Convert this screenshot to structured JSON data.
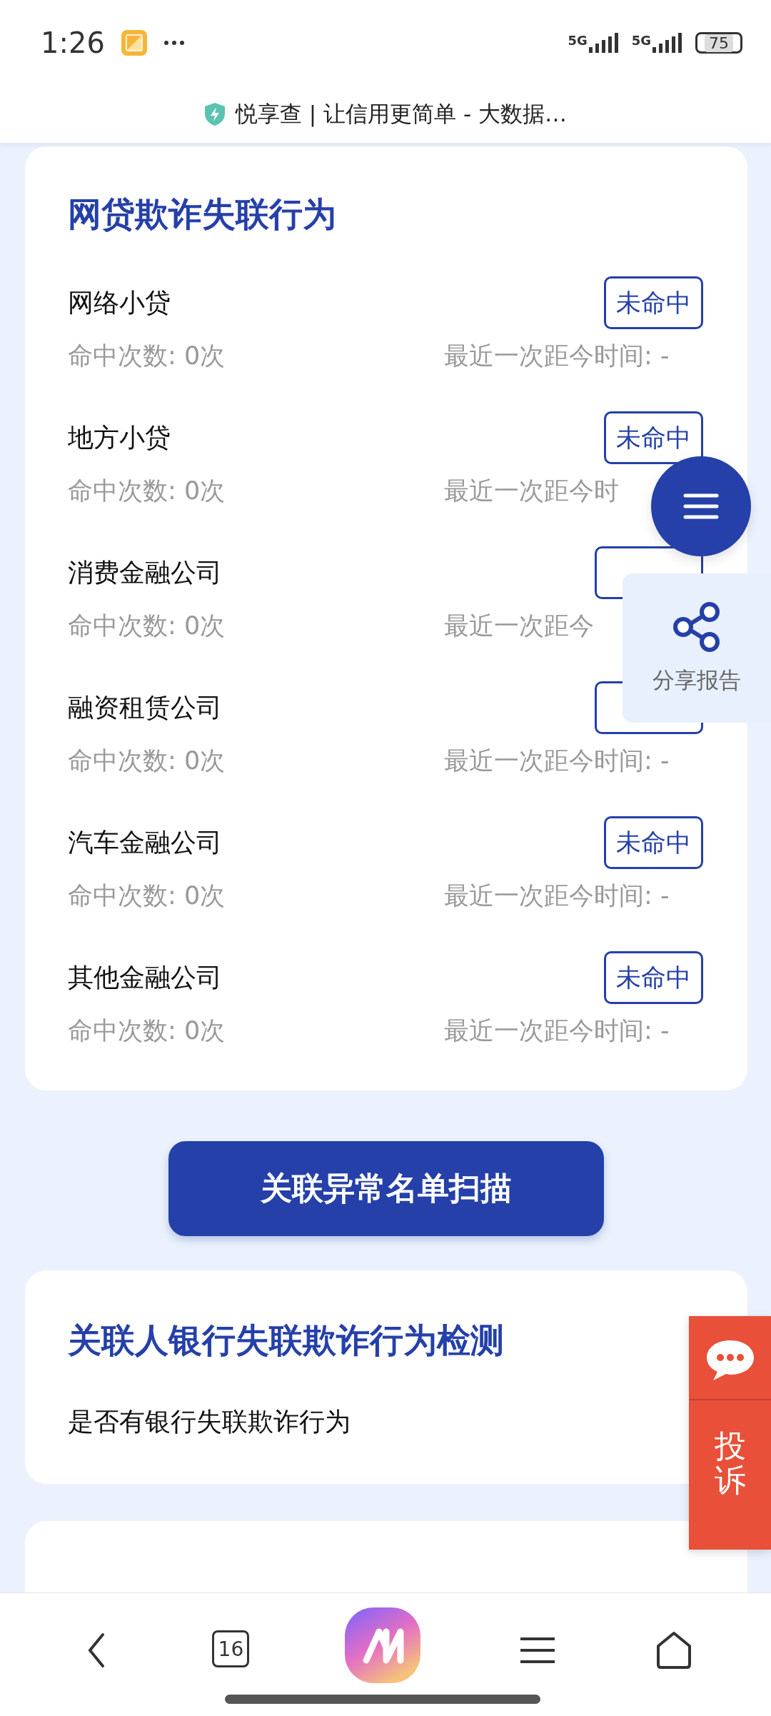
{
  "status_bar": {
    "time": "1:26",
    "network_1": "5G",
    "network_2": "5G",
    "battery": "75"
  },
  "browser_title": "悦享查 | 让信用更简单 - 大数据…",
  "sections": [
    {
      "kind": "hits",
      "title": "网贷欺诈失联行为",
      "rows": [
        {
          "name": "网络小贷",
          "badge": "未命中",
          "hits": "命中次数: 0次",
          "last": "最近一次距今时间: -"
        },
        {
          "name": "地方小贷",
          "badge": "未命中",
          "hits": "命中次数: 0次",
          "last": "最近一次距今时"
        },
        {
          "name": "消费金融公司",
          "hits": "命中次数: 0次",
          "last": "最近一次距今"
        },
        {
          "name": "融资租赁公司",
          "hits": "命中次数: 0次",
          "last": "最近一次距今时间: -"
        },
        {
          "name": "汽车金融公司",
          "badge": "未命中",
          "hits": "命中次数: 0次",
          "last": "最近一次距今时间: -"
        },
        {
          "name": "其他金融公司",
          "badge": "未命中",
          "hits": "命中次数: 0次",
          "last": "最近一次距今时间: -"
        }
      ]
    },
    {
      "kind": "button",
      "label": "关联异常名单扫描"
    },
    {
      "kind": "check",
      "title": "关联人银行失联欺诈行为检测",
      "rows": [
        {
          "label": "是否有银行失联欺诈行为"
        }
      ]
    },
    {
      "kind": "title"
    }
  ],
  "share": {
    "label": "分享报告"
  },
  "complaint": {
    "label": "投诉"
  },
  "nav": {
    "tabs": "16"
  }
}
